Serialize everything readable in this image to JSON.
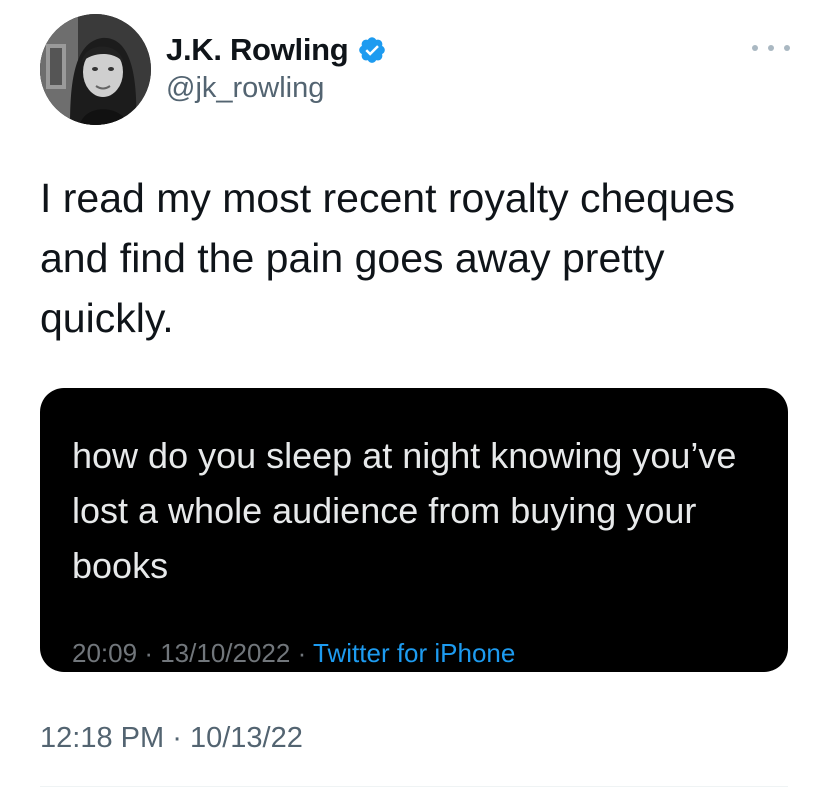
{
  "author": {
    "display_name": "J.K. Rowling",
    "handle": "@jk_rowling",
    "verified": true
  },
  "tweet": {
    "text": "I read my most recent royalty cheques\nand find the pain goes away pretty\nquickly.",
    "time": "12:18 PM",
    "separator": "·",
    "date": "10/13/22"
  },
  "quoted": {
    "text": "how do you sleep at night knowing you’ve lost a whole audience from buying your books",
    "time": "20:09",
    "separator1": "·",
    "date": "13/10/2022",
    "separator2": "·",
    "source": "Twitter for iPhone"
  },
  "colors": {
    "verified_badge": "#1d9bf0",
    "link": "#1d9bf0",
    "secondary_text": "#536471",
    "quote_background": "#000000"
  },
  "icons": {
    "verified": "verified-badge-icon",
    "more": "more-options-icon"
  }
}
